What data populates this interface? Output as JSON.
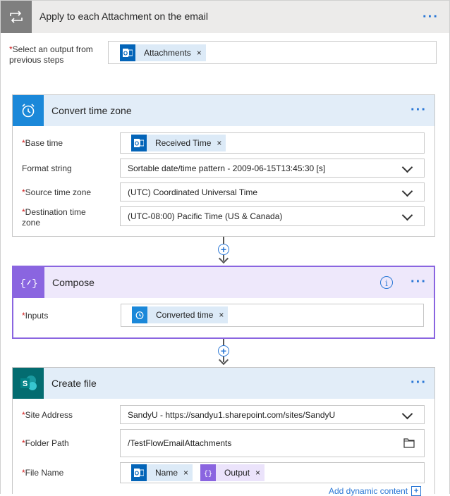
{
  "loop": {
    "title": "Apply to each Attachment on the email",
    "select_label": "Select an output from previous steps",
    "select_token": "Attachments"
  },
  "convert": {
    "title": "Convert time zone",
    "base_time_label": "Base time",
    "base_time_token": "Received Time",
    "format_label": "Format string",
    "format_value": "Sortable date/time pattern - 2009-06-15T13:45:30 [s]",
    "source_label": "Source time zone",
    "source_value": "(UTC) Coordinated Universal Time",
    "dest_label": "Destination time zone",
    "dest_value": "(UTC-08:00) Pacific Time (US & Canada)"
  },
  "compose": {
    "title": "Compose",
    "inputs_label": "Inputs",
    "inputs_token": "Converted time"
  },
  "create": {
    "title": "Create file",
    "site_label": "Site Address",
    "site_value": "SandyU - https://sandyu1.sharepoint.com/sites/SandyU",
    "folder_label": "Folder Path",
    "folder_value": "/TestFlowEmailAttachments",
    "file_label": "File Name",
    "file_token_1": "Name",
    "file_token_2": "Output",
    "add_dynamic": "Add dynamic content"
  },
  "common": {
    "required_mark": "*",
    "more_glyph": "···",
    "remove_glyph": "×",
    "plus_glyph": "+"
  },
  "colors": {
    "accent": "#2b78d6",
    "compose": "#8a65e0",
    "outlook": "#0364b8",
    "sharepoint": "#036c70"
  }
}
